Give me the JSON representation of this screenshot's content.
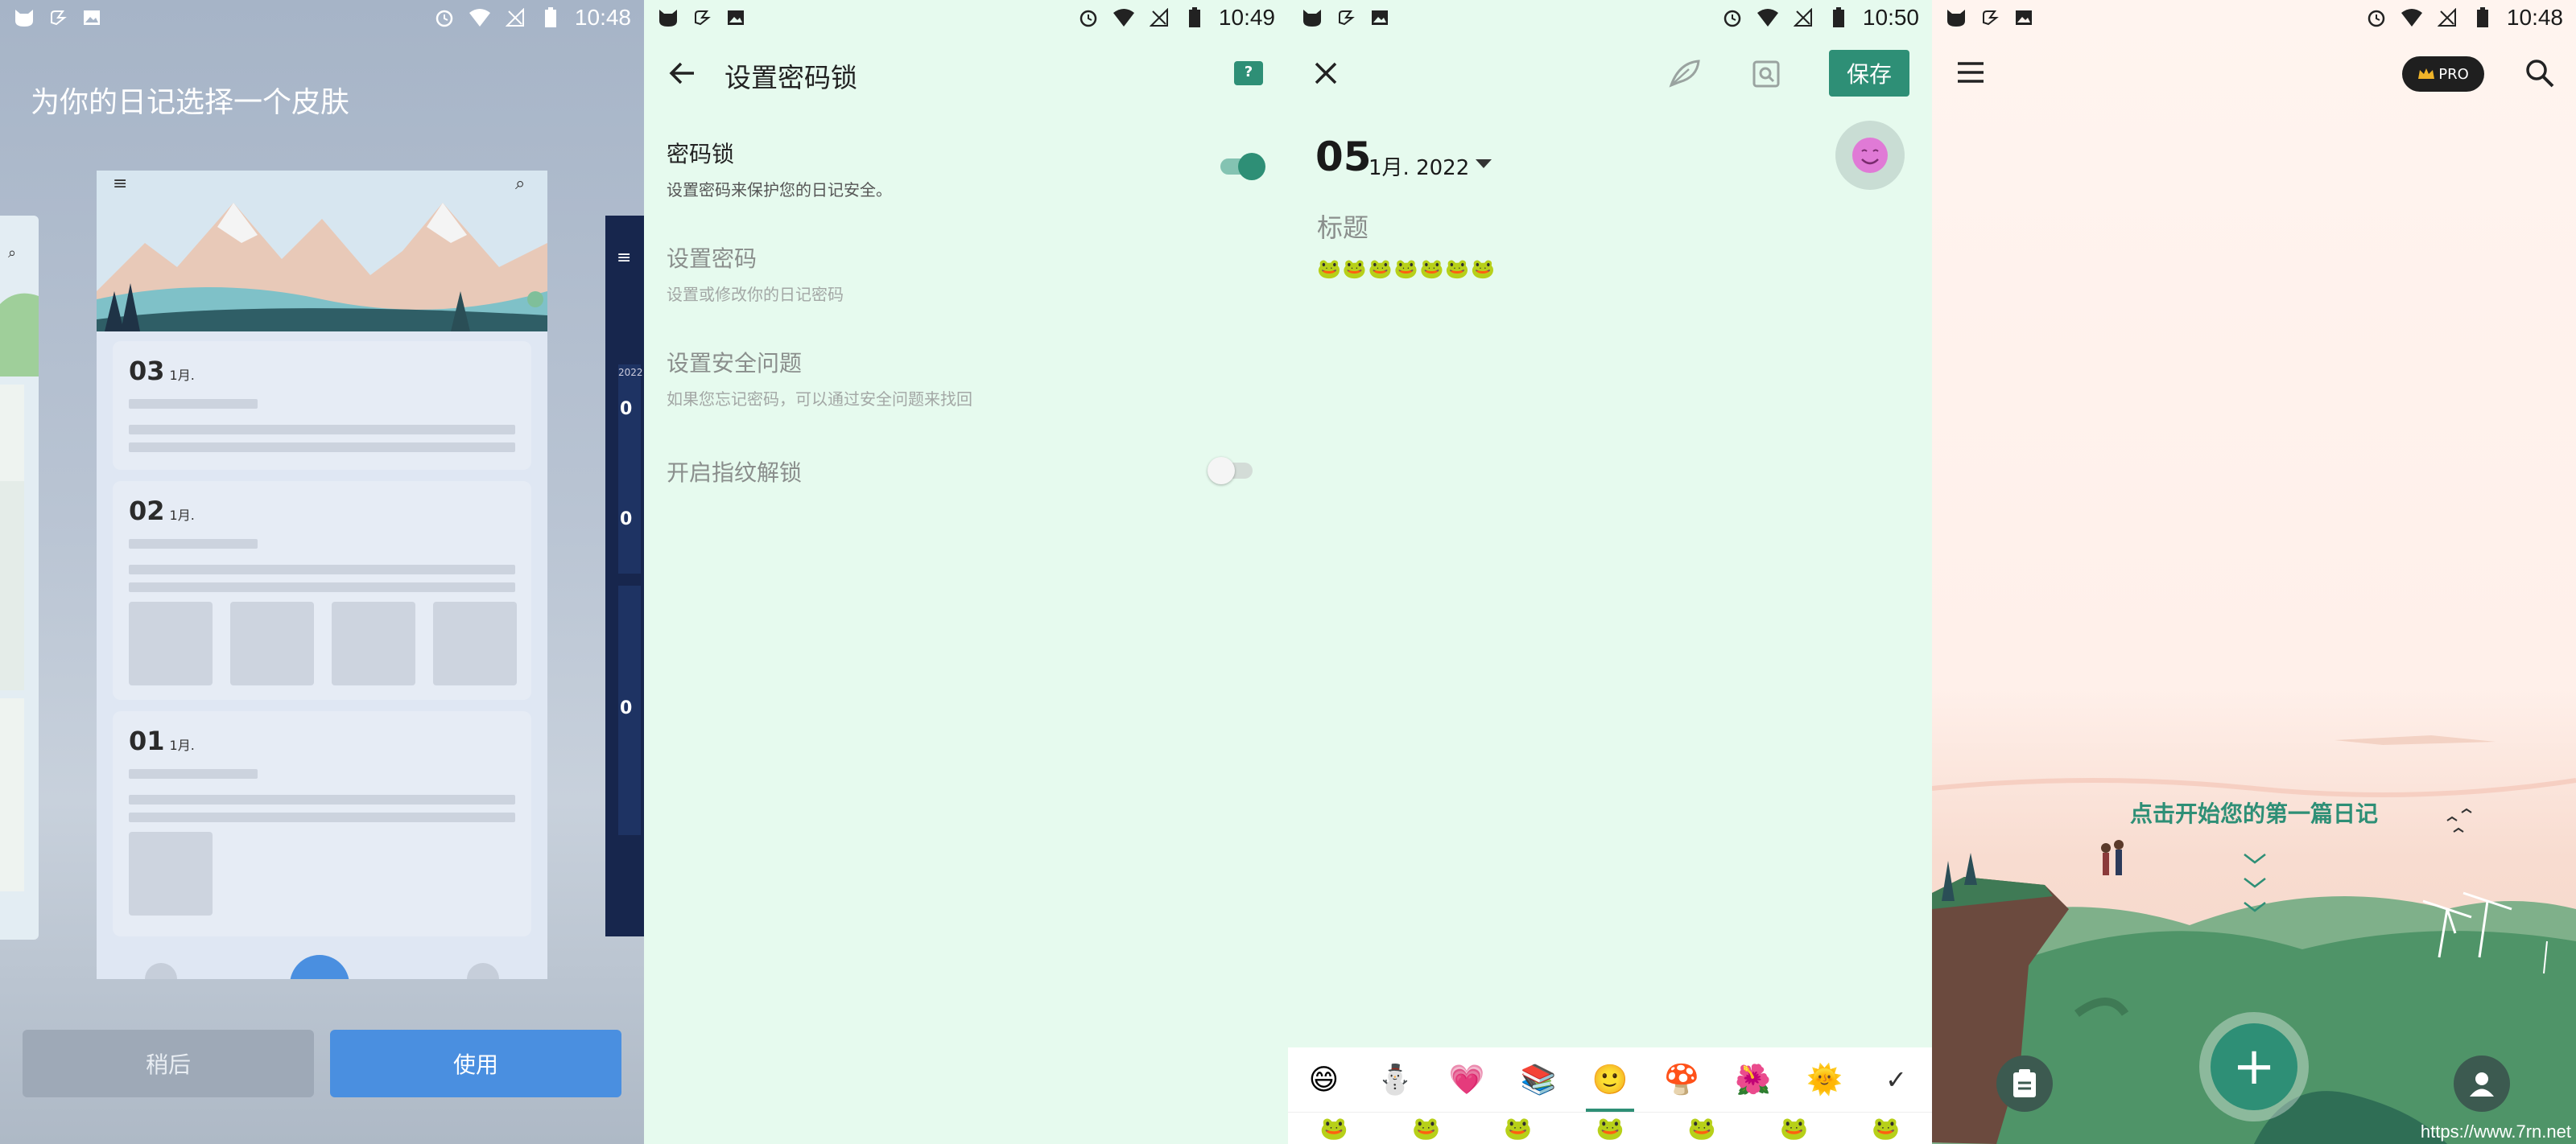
{
  "panel1": {
    "time": "10:48",
    "title": "为你的日记选择一个皮肤",
    "entries": [
      {
        "day": "03",
        "month": "1月."
      },
      {
        "day": "02",
        "month": "1月."
      },
      {
        "day": "01",
        "month": "1月."
      }
    ],
    "side_year": "2022",
    "side_days": [
      "0",
      "0",
      "0"
    ],
    "later_label": "稍后",
    "use_label": "使用"
  },
  "panel2": {
    "time": "10:49",
    "title": "设置密码锁",
    "help_label": "?",
    "settings": [
      {
        "title": "密码锁",
        "subtitle": "设置密码来保护您的日记安全。",
        "toggle": true
      },
      {
        "title": "设置密码",
        "subtitle": "设置或修改你的日记密码"
      },
      {
        "title": "设置安全问题",
        "subtitle": "如果您忘记密码，可以通过安全问题来找回"
      },
      {
        "title": "开启指纹解锁",
        "subtitle": "",
        "toggle": false
      }
    ]
  },
  "panel3": {
    "time": "10:50",
    "save_label": "保存",
    "date_day": "05",
    "date_rest": "1月. 2022",
    "title_placeholder": "标题",
    "body_text": "🐸🐸🐸🐸🐸🐸🐸",
    "emoji_tabs": [
      "😄",
      "⛄",
      "💗",
      "📚",
      "🙂",
      "🍄",
      "🌺",
      "🌞",
      "✓"
    ],
    "emoji_row2": [
      "🐸",
      "🐸",
      "🐸",
      "🐸",
      "🐸",
      "🐸",
      "🐸"
    ]
  },
  "panel4": {
    "time": "10:48",
    "pro_label": "PRO",
    "start_hint": "点击开始您的第一篇日记",
    "fab_label": "+",
    "watermark": "https://www.7rn.net"
  },
  "colors": {
    "accent": "#2e8f76",
    "blue": "#4a8fe0",
    "mint_bg": "#e6faee"
  }
}
